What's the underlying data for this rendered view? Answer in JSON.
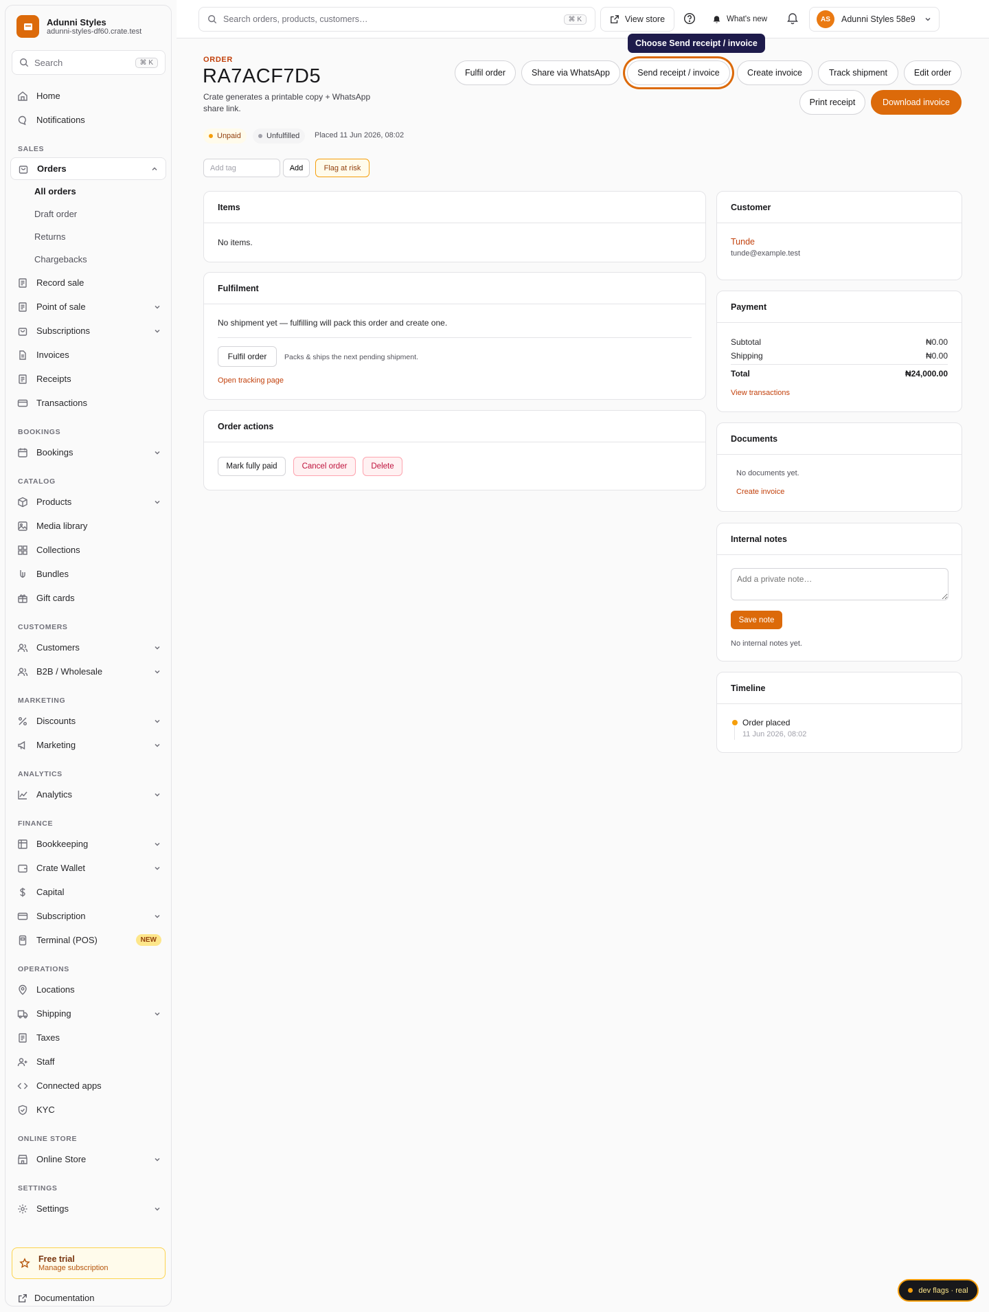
{
  "store": {
    "name": "Adunni Styles",
    "domain": "adunni-styles-df60.crate.test"
  },
  "sidebar": {
    "search_placeholder": "Search",
    "search_shortcut": "⌘ K",
    "home": "Home",
    "notifications": "Notifications",
    "section_sales": "SALES",
    "orders": "Orders",
    "orders_sub": [
      "All orders",
      "Draft order",
      "Returns",
      "Chargebacks"
    ],
    "record_sale": "Record sale",
    "point_of_sale": "Point of sale",
    "subscriptions": "Subscriptions",
    "invoices": "Invoices",
    "receipts": "Receipts",
    "transactions": "Transactions",
    "section_bookings": "BOOKINGS",
    "bookings": "Bookings",
    "section_catalog": "CATALOG",
    "products": "Products",
    "media_library": "Media library",
    "collections": "Collections",
    "bundles": "Bundles",
    "gift_cards": "Gift cards",
    "section_customers": "CUSTOMERS",
    "customers": "Customers",
    "b2b": "B2B / Wholesale",
    "section_marketing": "MARKETING",
    "discounts": "Discounts",
    "marketing": "Marketing",
    "section_analytics": "ANALYTICS",
    "analytics": "Analytics",
    "section_finance": "FINANCE",
    "bookkeeping": "Bookkeeping",
    "crate_wallet": "Crate Wallet",
    "capital": "Capital",
    "subscription": "Subscription",
    "terminal": "Terminal (POS)",
    "terminal_badge": "NEW",
    "section_operations": "OPERATIONS",
    "locations": "Locations",
    "shipping": "Shipping",
    "taxes": "Taxes",
    "staff": "Staff",
    "connected_apps": "Connected apps",
    "kyc": "KYC",
    "section_online_store": "ONLINE STORE",
    "online_store": "Online Store",
    "section_settings": "SETTINGS",
    "settings": "Settings",
    "trial_title": "Free trial",
    "trial_sub": "Manage subscription",
    "documentation": "Documentation"
  },
  "topbar": {
    "search_placeholder": "Search orders, products, customers…",
    "search_shortcut": "⌘ K",
    "view_store": "View store",
    "whats_new": "What's new",
    "avatar_initials": "AS",
    "account_name": "Adunni Styles 58e9"
  },
  "tooltip": "Choose Send receipt / invoice",
  "order": {
    "kicker": "ORDER",
    "id": "RA7ACF7D5",
    "subtitle": "Crate generates a printable copy + WhatsApp share link.",
    "payment_status": "Unpaid",
    "fulfilment_status": "Unfulfilled",
    "placed": "Placed 11 Jun 2026, 08:02"
  },
  "actions": {
    "fulfil": "Fulfil order",
    "whatsapp": "Share via WhatsApp",
    "send_receipt": "Send receipt / invoice",
    "create_invoice": "Create invoice",
    "track": "Track shipment",
    "edit": "Edit order",
    "print_receipt": "Print receipt",
    "download_invoice": "Download invoice"
  },
  "tags": {
    "placeholder": "Add tag",
    "add": "Add",
    "flag": "Flag at risk"
  },
  "items": {
    "title": "Items",
    "empty": "No items."
  },
  "fulfilment": {
    "title": "Fulfilment",
    "empty": "No shipment yet — fulfilling will pack this order and create one.",
    "button": "Fulfil order",
    "hint": "Packs & ships the next pending shipment.",
    "tracking_link": "Open tracking page"
  },
  "order_actions": {
    "title": "Order actions",
    "mark_paid": "Mark fully paid",
    "cancel": "Cancel order",
    "delete": "Delete"
  },
  "customer": {
    "title": "Customer",
    "name": "Tunde",
    "email": "tunde@example.test"
  },
  "payment": {
    "title": "Payment",
    "subtotal_label": "Subtotal",
    "subtotal": "₦0.00",
    "shipping_label": "Shipping",
    "shipping": "₦0.00",
    "total_label": "Total",
    "total": "₦24,000.00",
    "link": "View transactions"
  },
  "documents": {
    "title": "Documents",
    "empty": "No documents yet.",
    "link": "Create invoice"
  },
  "notes": {
    "title": "Internal notes",
    "placeholder": "Add a private note…",
    "save": "Save note",
    "empty": "No internal notes yet."
  },
  "timeline": {
    "title": "Timeline",
    "event": "Order placed",
    "time": "11 Jun 2026, 08:02"
  },
  "devflags": "dev flags · real",
  "colors": {
    "accent": "#dc6a0a",
    "tooltip": "#1e1b4b",
    "danger": "#be123c"
  }
}
